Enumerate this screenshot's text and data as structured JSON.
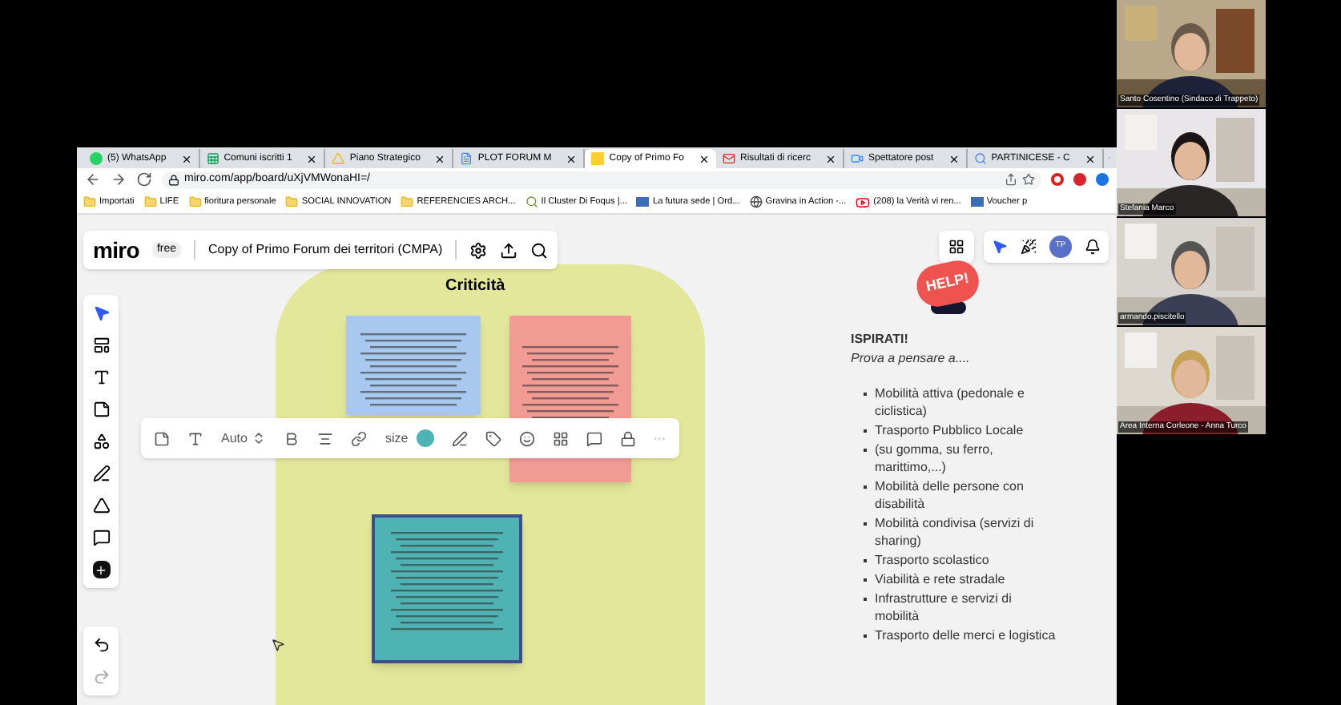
{
  "browser": {
    "tabs": [
      {
        "label": "(5) WhatsApp",
        "selected": false
      },
      {
        "label": "Comuni iscritti 1",
        "selected": false
      },
      {
        "label": "Piano Strategico",
        "selected": false
      },
      {
        "label": "PLOT FORUM M",
        "selected": false
      },
      {
        "label": "Copy of Primo Fo",
        "selected": true
      },
      {
        "label": "Risultati di ricerc",
        "selected": false
      },
      {
        "label": "Spettatore post",
        "selected": false
      },
      {
        "label": "PARTINICESE - C",
        "selected": false
      }
    ],
    "address": "miro.com/app/board/uXjVMWonaHI=/",
    "bookmarks": [
      "Importati",
      "LIFE",
      "fioritura personale",
      "SOCIAL INNOVATION",
      "REFERENCIES ARCH...",
      "Il Cluster Di Foqus |...",
      "La futura sede | Ord...",
      "Gravina in Action -...",
      "(208) la Verità vi ren...",
      "Voucher p"
    ]
  },
  "miro": {
    "logo": "miro",
    "plan": "free",
    "board_title": "Copy of Primo Forum dei territori (CMPA)",
    "avatar": "TP",
    "frame_title": "Criticità",
    "stickies": [
      {
        "color": "#a9c8f0",
        "selected": false
      },
      {
        "color": "#f29a94",
        "selected": false
      },
      {
        "color": "#4fb3b3",
        "selected": true
      }
    ],
    "toolbar": {
      "font_label": "Auto",
      "size_label": "size",
      "color": "#4fb3b3",
      "more": "···"
    },
    "sticker": "HELP!",
    "panel": {
      "heading": "ISPIRATI!",
      "subheading": "Prova a pensare a....",
      "items": [
        "Mobilità attiva (pedonale e ciclistica)",
        "Trasporto Pubblico Locale",
        "(su gomma, su ferro, marittimo,...)",
        "Mobilità delle persone con disabilità",
        "Mobilità condivisa (servizi di sharing)",
        "Trasporto scolastico",
        "Viabilità e rete stradale",
        "Infrastrutture e servizi di mobilità",
        "Trasporto delle merci e logistica"
      ]
    }
  },
  "participants": [
    {
      "name": "Santo Cosentino (Sindaco di Trappeto)",
      "kind": "picture"
    },
    {
      "name": "Stefania Marco",
      "kind": "picture"
    },
    {
      "name": "armando.piscitello",
      "kind": "picture"
    },
    {
      "name": "Area Interna Corleone - Anna Turco",
      "kind": "picture"
    }
  ]
}
